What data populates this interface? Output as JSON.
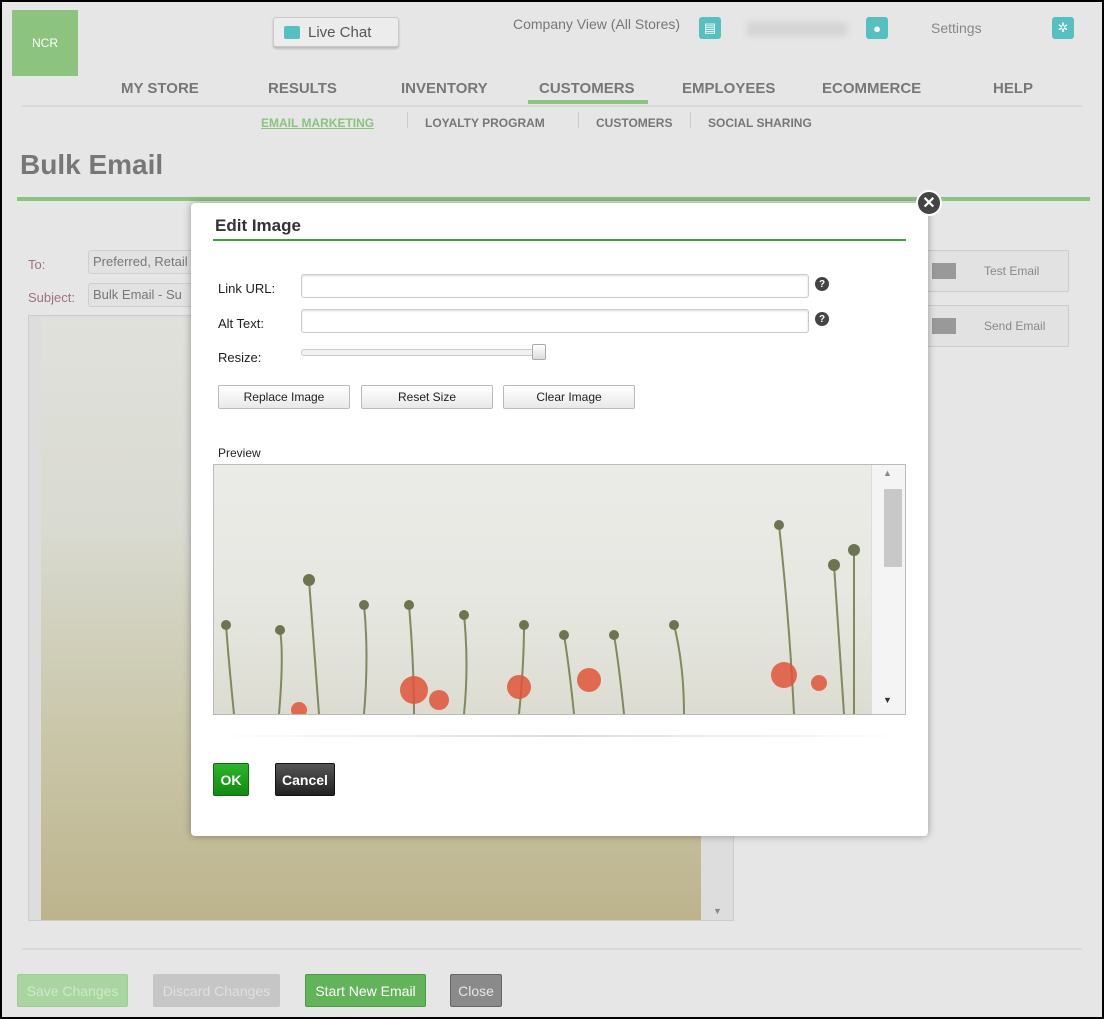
{
  "header": {
    "logo": "NCR",
    "live_chat": "Live Chat",
    "company_view": "Company View (All Stores)",
    "settings": "Settings"
  },
  "nav": [
    "MY STORE",
    "RESULTS",
    "INVENTORY",
    "CUSTOMERS",
    "EMPLOYEES",
    "ECOMMERCE",
    "HELP"
  ],
  "nav_active": "CUSTOMERS",
  "subnav": [
    "EMAIL MARKETING",
    "LOYALTY PROGRAM",
    "CUSTOMERS",
    "SOCIAL SHARING"
  ],
  "page": {
    "title": "Bulk Email",
    "to_label": "To:",
    "to_value": "Preferred, Retail",
    "subject_label": "Subject:",
    "subject_value": "Bulk Email  -  Su",
    "test_email": "Test Email",
    "send_email": "Send Email"
  },
  "footer": {
    "save": "Save Changes",
    "discard": "Discard Changes",
    "start": "Start New Email",
    "close": "Close"
  },
  "dialog": {
    "title": "Edit Image",
    "link_url_label": "Link URL:",
    "link_url_value": "",
    "alt_text_label": "Alt Text:",
    "alt_text_value": "",
    "resize_label": "Resize:",
    "resize_value": 1.0,
    "replace": "Replace Image",
    "reset": "Reset Size",
    "clear": "Clear Image",
    "preview_label": "Preview",
    "ok": "OK",
    "cancel": "Cancel"
  },
  "colors": {
    "brand_green": "#8cc37f",
    "accent_teal": "#56c0c0",
    "ok_green": "#1a9a1a"
  }
}
